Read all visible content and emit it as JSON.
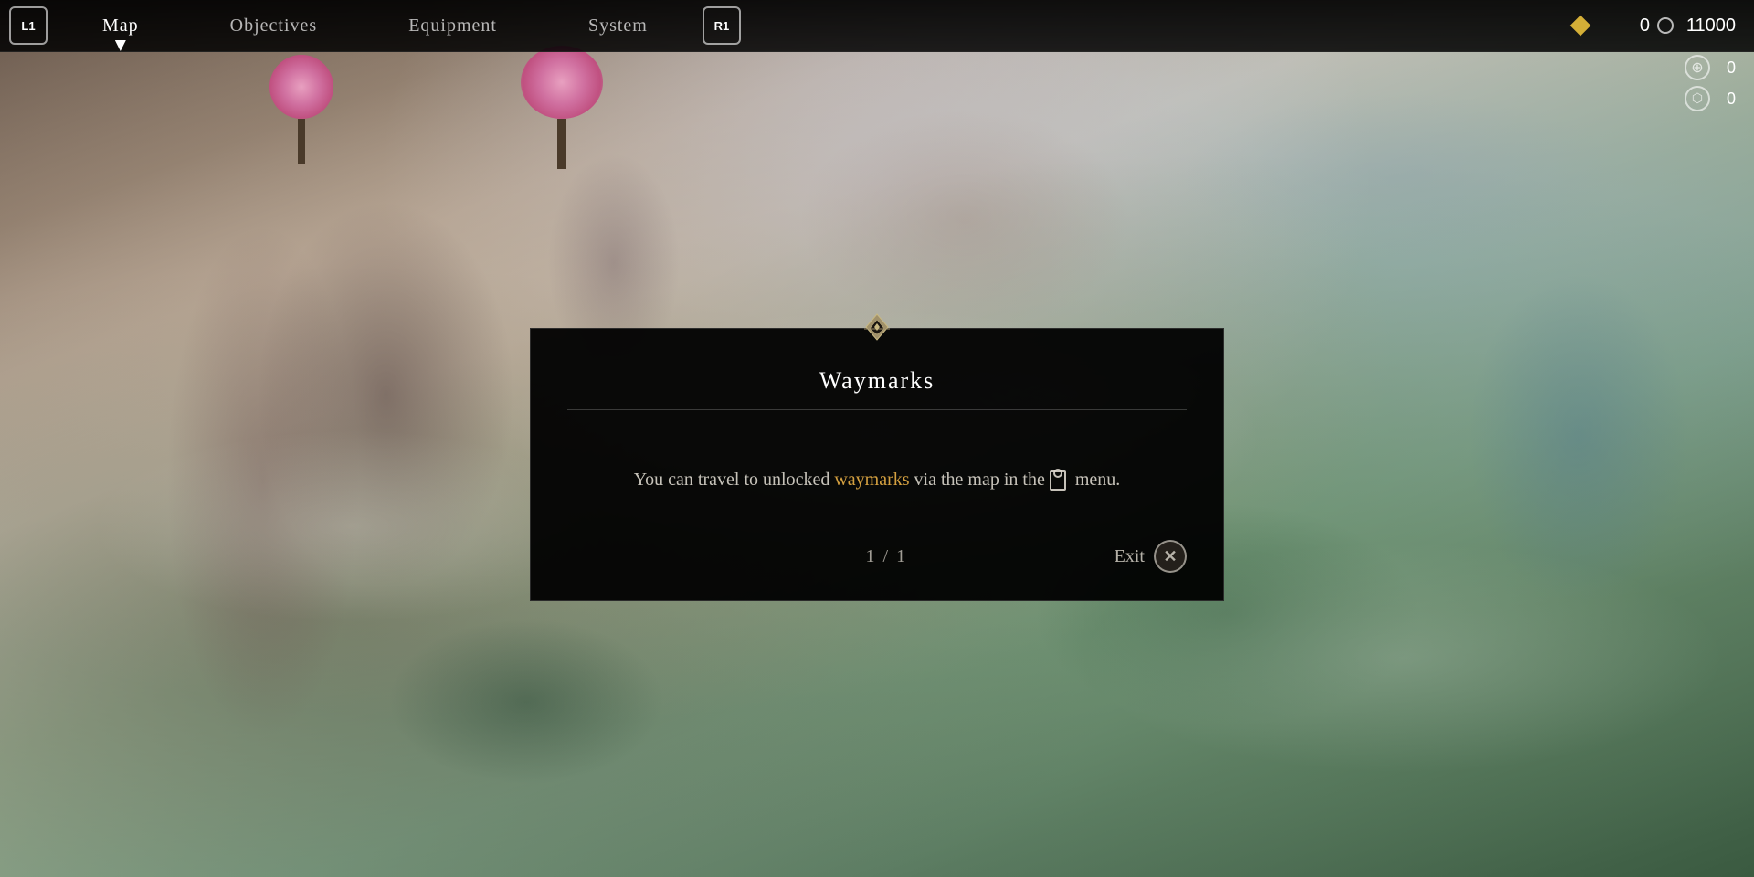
{
  "nav": {
    "button_l1": "L1",
    "button_r1": "R1",
    "tabs": [
      {
        "label": "Map",
        "active": true
      },
      {
        "label": "Objectives",
        "active": false
      },
      {
        "label": "Equipment",
        "active": false
      },
      {
        "label": "System",
        "active": false
      }
    ],
    "currency": {
      "diamond_value": "0",
      "circle_value": "11000",
      "globe_value": "0",
      "bag_value": "0"
    }
  },
  "modal": {
    "title": "Waymarks",
    "body_text_1": "You can travel to unlocked ",
    "body_highlight": "waymarks",
    "body_text_2": " via the map in the",
    "body_text_3": " menu.",
    "page_indicator": "1 / 1",
    "exit_label": "Exit"
  }
}
